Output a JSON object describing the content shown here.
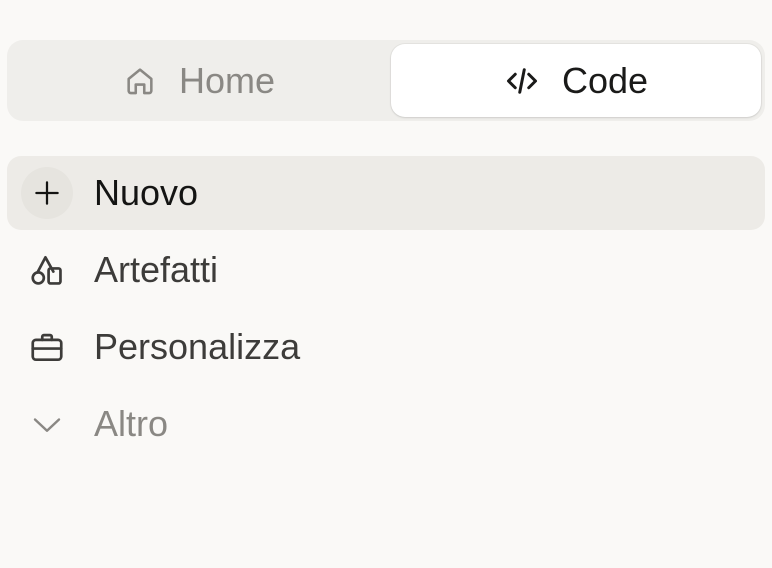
{
  "tabs": [
    {
      "label": "Home",
      "icon": "home-icon",
      "selected": false
    },
    {
      "label": "Code",
      "icon": "code-icon",
      "selected": true
    }
  ],
  "menu": {
    "items": [
      {
        "label": "Nuovo",
        "icon": "plus-icon"
      },
      {
        "label": "Artefatti",
        "icon": "shapes-icon"
      },
      {
        "label": "Personalizza",
        "icon": "briefcase-icon"
      },
      {
        "label": "Altro",
        "icon": "chevron-down-icon"
      }
    ]
  },
  "colors": {
    "background": "#faf9f7",
    "tab_bar": "#efeeeb",
    "active_item": "#edebe7",
    "muted_text": "#8a8884"
  }
}
